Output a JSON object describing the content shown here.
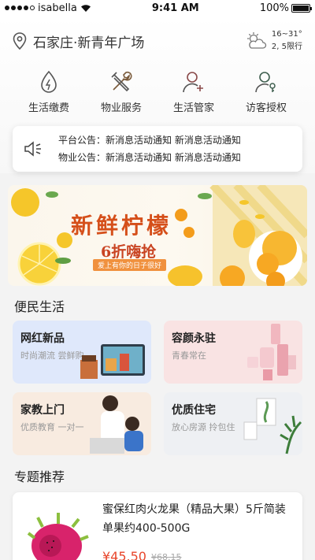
{
  "status_bar": {
    "carrier": "isabella",
    "time": "9:41 AM",
    "battery": "100%",
    "battery_level": 1.0
  },
  "header": {
    "location": "石家庄·新青年广场",
    "weather": {
      "temp": "16~31°",
      "limit": "2, 5限行",
      "icon": "partly-cloudy-icon"
    }
  },
  "services": [
    {
      "label": "生活缴费",
      "icon": "utility-payment-icon"
    },
    {
      "label": "物业服务",
      "icon": "tools-icon"
    },
    {
      "label": "生活管家",
      "icon": "add-user-icon"
    },
    {
      "label": "访客授权",
      "icon": "visitor-key-icon"
    }
  ],
  "notice": {
    "icon": "speaker-icon",
    "lines": [
      "平台公告：新消息活动通知 新消息活动通知",
      "物业公告：新消息活动通知 新消息活动通知"
    ]
  },
  "banner": {
    "title": "新鲜柠檬",
    "subtitle": "6折嗨抢",
    "tag": "爱上有你的日子很好"
  },
  "convenience": {
    "title": "便民生活",
    "cards": [
      {
        "title": "网红新品",
        "subtitle": "时尚潮流 尝鲜购",
        "color": "#dfe8fb"
      },
      {
        "title": "容颜永驻",
        "subtitle": "青春常在",
        "color": "#f9e3e3"
      },
      {
        "title": "家教上门",
        "subtitle": "优质教育 一对一",
        "color": "#f8ebe0"
      },
      {
        "title": "优质住宅",
        "subtitle": "放心房源 拎包住",
        "color": "#eef0f3"
      }
    ]
  },
  "featured": {
    "title": "专题推荐",
    "product": {
      "name": "蜜保红肉火龙果（精品大果）5斤简装 单果约400-500G",
      "price": "¥45.50",
      "old_price": "¥68.15"
    }
  }
}
